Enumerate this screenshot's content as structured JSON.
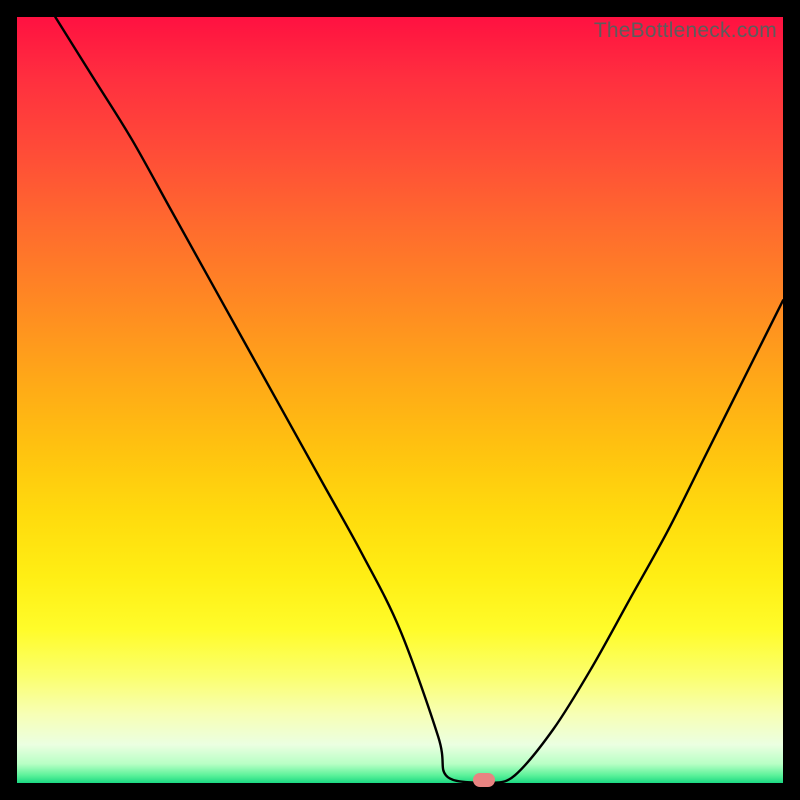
{
  "watermark": "TheBottleneck.com",
  "chart_data": {
    "type": "line",
    "title": "",
    "xlabel": "",
    "ylabel": "",
    "xlim": [
      0,
      100
    ],
    "ylim": [
      0,
      100
    ],
    "series": [
      {
        "name": "bottleneck-curve",
        "x": [
          5,
          10,
          15,
          20,
          25,
          30,
          35,
          40,
          45,
          50,
          55,
          56,
          60,
          62,
          65,
          70,
          75,
          80,
          85,
          90,
          95,
          100
        ],
        "y": [
          100,
          92,
          84,
          75,
          66,
          57,
          48,
          39,
          30,
          20,
          6,
          1,
          0,
          0,
          1,
          7,
          15,
          24,
          33,
          43,
          53,
          63
        ]
      }
    ],
    "marker": {
      "x": 61,
      "y": 0,
      "color": "#e88381"
    },
    "gradient_stops": [
      {
        "pct": 0,
        "color": "#ff1141"
      },
      {
        "pct": 80,
        "color": "#fffc2a"
      },
      {
        "pct": 100,
        "color": "#1bd882"
      }
    ]
  }
}
